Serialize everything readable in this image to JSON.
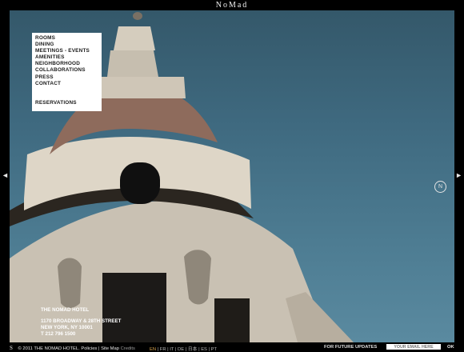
{
  "brand": "NoMad",
  "navigation": {
    "items": [
      "ROOMS",
      "DINING",
      "MEETINGS - EVENTS",
      "AMENITIES",
      "NEIGHBORHOOD",
      "COLLABORATIONS",
      "PRESS",
      "CONTACT"
    ],
    "reservations": "RESERVATIONS"
  },
  "hotel": {
    "name": "THE NOMAD HOTEL",
    "address_line1": "1170 BROADWAY & 28TH STREET",
    "address_line2": "NEW YORK, NY 10001",
    "phone_prefix": "T",
    "phone": "212 796 1500"
  },
  "footer": {
    "signature": "S",
    "copyright": "© 2011 THE NOMAD HOTEL.",
    "policies": "Policies",
    "sitemap": "Site Map",
    "credits": "Credits",
    "languages": [
      "EN",
      "FR",
      "IT",
      "DE",
      "日本",
      "ES",
      "PT"
    ],
    "active_language": "EN",
    "updates_label": "FOR FUTURE UPDATES",
    "email_placeholder": "YOUR EMAIL HERE",
    "ok_label": "OK"
  },
  "arrows": {
    "left": "◄",
    "right": "►"
  },
  "logo_mark": "N",
  "colors": {
    "active_language": "#d6a24b",
    "sky": "#4a7890"
  }
}
